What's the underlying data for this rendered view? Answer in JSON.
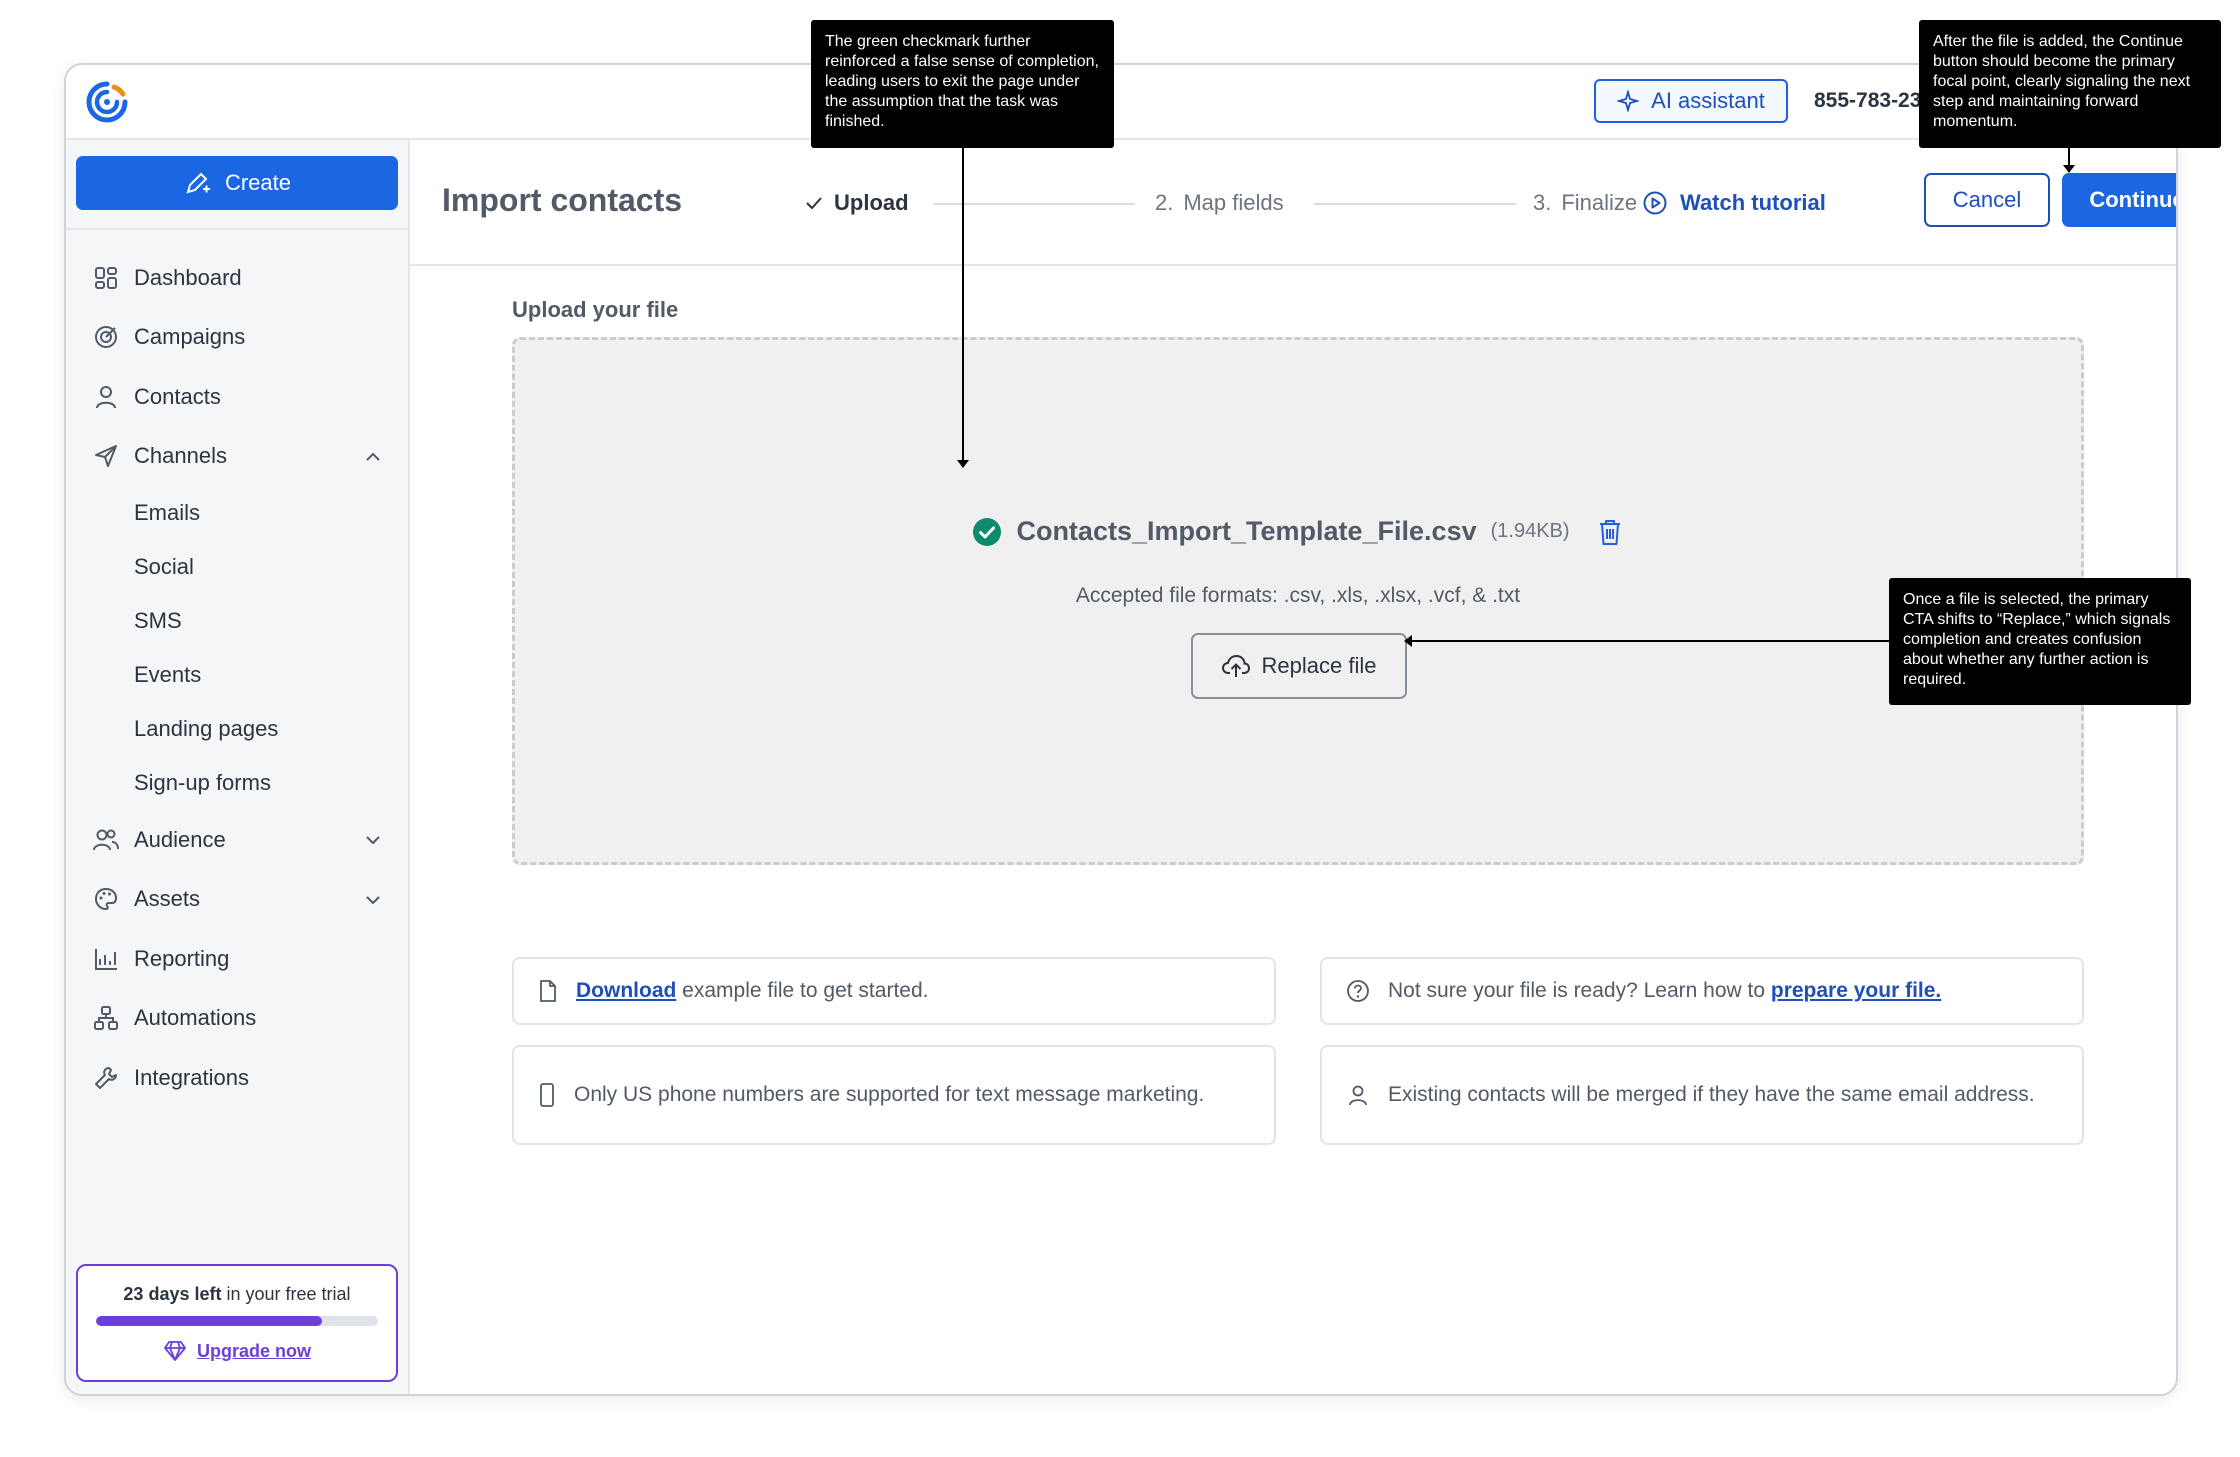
{
  "topbar": {
    "ai_assistant_label": "AI assistant",
    "phone": "855-783-23"
  },
  "sidebar": {
    "create_label": "Create",
    "items": [
      {
        "label": "Dashboard",
        "icon": "dashboard-icon"
      },
      {
        "label": "Campaigns",
        "icon": "campaigns-icon"
      },
      {
        "label": "Contacts",
        "icon": "contacts-icon"
      },
      {
        "label": "Channels",
        "icon": "channels-icon",
        "expanded": true
      },
      {
        "label": "Audience",
        "icon": "audience-icon",
        "expanded": false
      },
      {
        "label": "Assets",
        "icon": "assets-icon",
        "expanded": false
      },
      {
        "label": "Reporting",
        "icon": "reporting-icon"
      },
      {
        "label": "Automations",
        "icon": "automations-icon"
      },
      {
        "label": "Integrations",
        "icon": "integrations-icon"
      }
    ],
    "channels_sub": [
      "Emails",
      "Social",
      "SMS",
      "Events",
      "Landing pages",
      "Sign-up forms"
    ],
    "trial": {
      "days_left": "23 days left",
      "suffix": "in your free trial",
      "progress": 0.8,
      "upgrade_label": "Upgrade now"
    }
  },
  "header": {
    "title": "Import contacts",
    "steps": [
      {
        "label": "Upload",
        "state": "done"
      },
      {
        "number": "2.",
        "label": "Map fields"
      },
      {
        "number": "3.",
        "label": "Finalize"
      }
    ],
    "watch_tutorial": "Watch tutorial",
    "cancel": "Cancel",
    "continue": "Continue"
  },
  "upload": {
    "section_title": "Upload your file",
    "file_name": "Contacts_Import_Template_File.csv",
    "file_size": "(1.94KB)",
    "formats": "Accepted file formats: .csv, .xls, .xlsx, .vcf, & .txt",
    "replace_label": "Replace file"
  },
  "info": {
    "download_link": "Download",
    "download_rest": "example file to get started.",
    "prepare_text": "Not sure your file is ready? Learn how to",
    "prepare_link": "prepare your file.",
    "phone_note": "Only US phone numbers are supported for text message marketing.",
    "merge_note": "Existing contacts will be merged if they have the same email address."
  },
  "callouts": {
    "checkmark": "The green checkmark further reinforced a false sense of completion, leading users to exit the page under the assumption that the task was finished.",
    "continue": "After the file is added, the Continue button should become the primary focal point, clearly signaling the next step and maintaining forward momentum.",
    "replace": "Once a file is selected, the primary CTA shifts to “Replace,” which signals completion and creates confusion about whether any further action is required."
  },
  "colors": {
    "primary": "#1a66e3",
    "success": "#0f8a6c",
    "trial": "#6d3fd9"
  }
}
